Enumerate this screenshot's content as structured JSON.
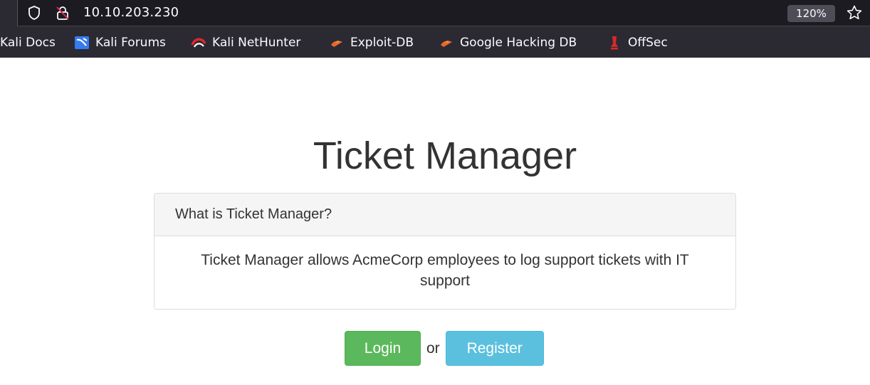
{
  "browser": {
    "url": "10.10.203.230",
    "zoom": "120%",
    "bookmarks": [
      {
        "label": "Kali Docs",
        "icon": "kali-docs-icon"
      },
      {
        "label": "Kali Forums",
        "icon": "kali-forums-icon"
      },
      {
        "label": "Kali NetHunter",
        "icon": "kali-nethunter-icon"
      },
      {
        "label": "Exploit-DB",
        "icon": "exploit-db-icon"
      },
      {
        "label": "Google Hacking DB",
        "icon": "ghdb-icon"
      },
      {
        "label": "OffSec",
        "icon": "offsec-icon"
      }
    ]
  },
  "page": {
    "title": "Ticket Manager",
    "panel": {
      "heading": "What is Ticket Manager?",
      "body": "Ticket Manager allows AcmeCorp employees to log support tickets with IT support"
    },
    "actions": {
      "login_label": "Login",
      "separator": "or",
      "register_label": "Register"
    }
  },
  "colors": {
    "login": "#5cb85c",
    "register": "#5bc0de",
    "text": "#333333"
  }
}
